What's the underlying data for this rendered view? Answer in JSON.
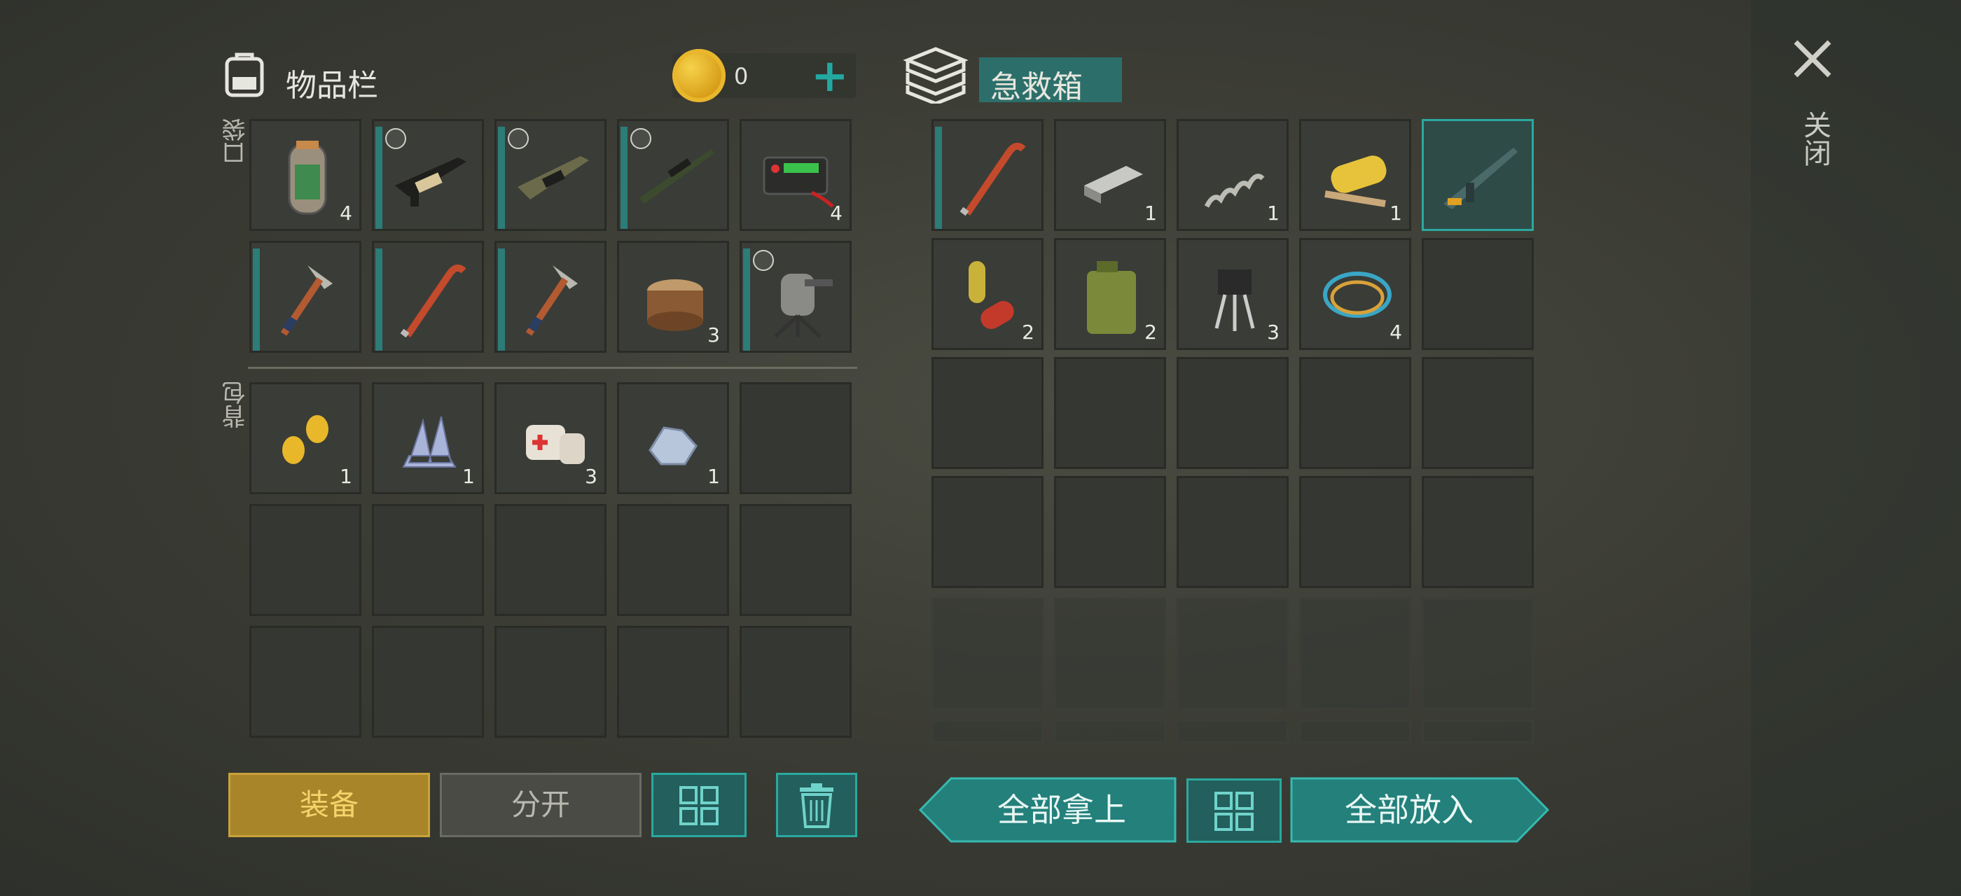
{
  "inventory": {
    "title": "物品栏",
    "coins": "0",
    "plus": "+"
  },
  "sections": {
    "pockets": "口袋",
    "backpack": "背包"
  },
  "container": {
    "title": "急救箱"
  },
  "pocket_slots": [
    {
      "icon": "oxygen-canister-icon",
      "count": "4",
      "shield": false,
      "bar": false
    },
    {
      "icon": "assault-rifle-icon",
      "count": "",
      "shield": true,
      "bar": true
    },
    {
      "icon": "camo-rifle-icon",
      "count": "",
      "shield": true,
      "bar": true
    },
    {
      "icon": "sniper-rifle-icon",
      "count": "",
      "shield": true,
      "bar": true
    },
    {
      "icon": "battery-icon",
      "count": "4",
      "shield": false,
      "bar": false
    },
    {
      "icon": "pickaxe-icon",
      "count": "",
      "shield": false,
      "bar": true
    },
    {
      "icon": "crowbar-icon",
      "count": "",
      "shield": false,
      "bar": true
    },
    {
      "icon": "pickaxe-icon",
      "count": "",
      "shield": false,
      "bar": true
    },
    {
      "icon": "wood-log-icon",
      "count": "3",
      "shield": false,
      "bar": false
    },
    {
      "icon": "turret-icon",
      "count": "",
      "shield": true,
      "bar": true
    }
  ],
  "backpack_slots": [
    {
      "icon": "corn-seeds-icon",
      "count": "1"
    },
    {
      "icon": "crystal-icon",
      "count": "1"
    },
    {
      "icon": "bandage-icon",
      "count": "3"
    },
    {
      "icon": "metal-ore-icon",
      "count": "1"
    }
  ],
  "container_slots": [
    {
      "icon": "crowbar-icon",
      "count": "",
      "bar": true
    },
    {
      "icon": "metal-bar-icon",
      "count": "1"
    },
    {
      "icon": "spring-icon",
      "count": "1"
    },
    {
      "icon": "fabric-roll-icon",
      "count": "1"
    },
    {
      "icon": "rifle-icon",
      "count": "",
      "selected": true
    },
    {
      "icon": "pills-icon",
      "count": "2"
    },
    {
      "icon": "jerry-can-icon",
      "count": "2"
    },
    {
      "icon": "transistor-icon",
      "count": "3"
    },
    {
      "icon": "wire-icon",
      "count": "4"
    }
  ],
  "buttons": {
    "equip": "装备",
    "split": "分开",
    "take_all": "全部拿上",
    "put_all": "全部放入",
    "close": "关闭"
  },
  "colors": {
    "accent": "#23807b",
    "equip": "#a9852a"
  }
}
